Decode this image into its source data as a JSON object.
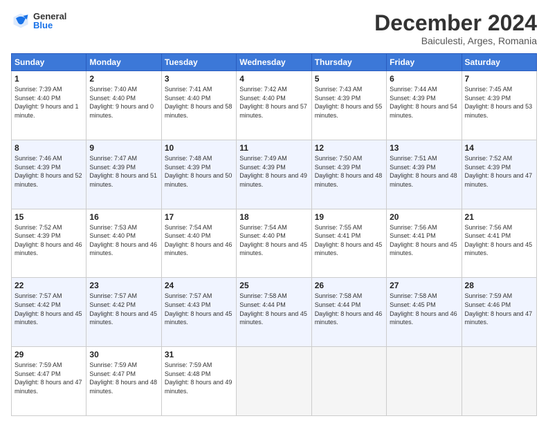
{
  "logo": {
    "general": "General",
    "blue": "Blue"
  },
  "header": {
    "month": "December 2024",
    "location": "Baiculesti, Arges, Romania"
  },
  "days_of_week": [
    "Sunday",
    "Monday",
    "Tuesday",
    "Wednesday",
    "Thursday",
    "Friday",
    "Saturday"
  ],
  "weeks": [
    [
      {
        "day": "1",
        "sunrise": "7:39 AM",
        "sunset": "4:40 PM",
        "daylight": "9 hours and 1 minute."
      },
      {
        "day": "2",
        "sunrise": "7:40 AM",
        "sunset": "4:40 PM",
        "daylight": "9 hours and 0 minutes."
      },
      {
        "day": "3",
        "sunrise": "7:41 AM",
        "sunset": "4:40 PM",
        "daylight": "8 hours and 58 minutes."
      },
      {
        "day": "4",
        "sunrise": "7:42 AM",
        "sunset": "4:40 PM",
        "daylight": "8 hours and 57 minutes."
      },
      {
        "day": "5",
        "sunrise": "7:43 AM",
        "sunset": "4:39 PM",
        "daylight": "8 hours and 55 minutes."
      },
      {
        "day": "6",
        "sunrise": "7:44 AM",
        "sunset": "4:39 PM",
        "daylight": "8 hours and 54 minutes."
      },
      {
        "day": "7",
        "sunrise": "7:45 AM",
        "sunset": "4:39 PM",
        "daylight": "8 hours and 53 minutes."
      }
    ],
    [
      {
        "day": "8",
        "sunrise": "7:46 AM",
        "sunset": "4:39 PM",
        "daylight": "8 hours and 52 minutes."
      },
      {
        "day": "9",
        "sunrise": "7:47 AM",
        "sunset": "4:39 PM",
        "daylight": "8 hours and 51 minutes."
      },
      {
        "day": "10",
        "sunrise": "7:48 AM",
        "sunset": "4:39 PM",
        "daylight": "8 hours and 50 minutes."
      },
      {
        "day": "11",
        "sunrise": "7:49 AM",
        "sunset": "4:39 PM",
        "daylight": "8 hours and 49 minutes."
      },
      {
        "day": "12",
        "sunrise": "7:50 AM",
        "sunset": "4:39 PM",
        "daylight": "8 hours and 48 minutes."
      },
      {
        "day": "13",
        "sunrise": "7:51 AM",
        "sunset": "4:39 PM",
        "daylight": "8 hours and 48 minutes."
      },
      {
        "day": "14",
        "sunrise": "7:52 AM",
        "sunset": "4:39 PM",
        "daylight": "8 hours and 47 minutes."
      }
    ],
    [
      {
        "day": "15",
        "sunrise": "7:52 AM",
        "sunset": "4:39 PM",
        "daylight": "8 hours and 46 minutes."
      },
      {
        "day": "16",
        "sunrise": "7:53 AM",
        "sunset": "4:40 PM",
        "daylight": "8 hours and 46 minutes."
      },
      {
        "day": "17",
        "sunrise": "7:54 AM",
        "sunset": "4:40 PM",
        "daylight": "8 hours and 46 minutes."
      },
      {
        "day": "18",
        "sunrise": "7:54 AM",
        "sunset": "4:40 PM",
        "daylight": "8 hours and 45 minutes."
      },
      {
        "day": "19",
        "sunrise": "7:55 AM",
        "sunset": "4:41 PM",
        "daylight": "8 hours and 45 minutes."
      },
      {
        "day": "20",
        "sunrise": "7:56 AM",
        "sunset": "4:41 PM",
        "daylight": "8 hours and 45 minutes."
      },
      {
        "day": "21",
        "sunrise": "7:56 AM",
        "sunset": "4:41 PM",
        "daylight": "8 hours and 45 minutes."
      }
    ],
    [
      {
        "day": "22",
        "sunrise": "7:57 AM",
        "sunset": "4:42 PM",
        "daylight": "8 hours and 45 minutes."
      },
      {
        "day": "23",
        "sunrise": "7:57 AM",
        "sunset": "4:42 PM",
        "daylight": "8 hours and 45 minutes."
      },
      {
        "day": "24",
        "sunrise": "7:57 AM",
        "sunset": "4:43 PM",
        "daylight": "8 hours and 45 minutes."
      },
      {
        "day": "25",
        "sunrise": "7:58 AM",
        "sunset": "4:44 PM",
        "daylight": "8 hours and 45 minutes."
      },
      {
        "day": "26",
        "sunrise": "7:58 AM",
        "sunset": "4:44 PM",
        "daylight": "8 hours and 46 minutes."
      },
      {
        "day": "27",
        "sunrise": "7:58 AM",
        "sunset": "4:45 PM",
        "daylight": "8 hours and 46 minutes."
      },
      {
        "day": "28",
        "sunrise": "7:59 AM",
        "sunset": "4:46 PM",
        "daylight": "8 hours and 47 minutes."
      }
    ],
    [
      {
        "day": "29",
        "sunrise": "7:59 AM",
        "sunset": "4:47 PM",
        "daylight": "8 hours and 47 minutes."
      },
      {
        "day": "30",
        "sunrise": "7:59 AM",
        "sunset": "4:47 PM",
        "daylight": "8 hours and 48 minutes."
      },
      {
        "day": "31",
        "sunrise": "7:59 AM",
        "sunset": "4:48 PM",
        "daylight": "8 hours and 49 minutes."
      },
      null,
      null,
      null,
      null
    ]
  ]
}
